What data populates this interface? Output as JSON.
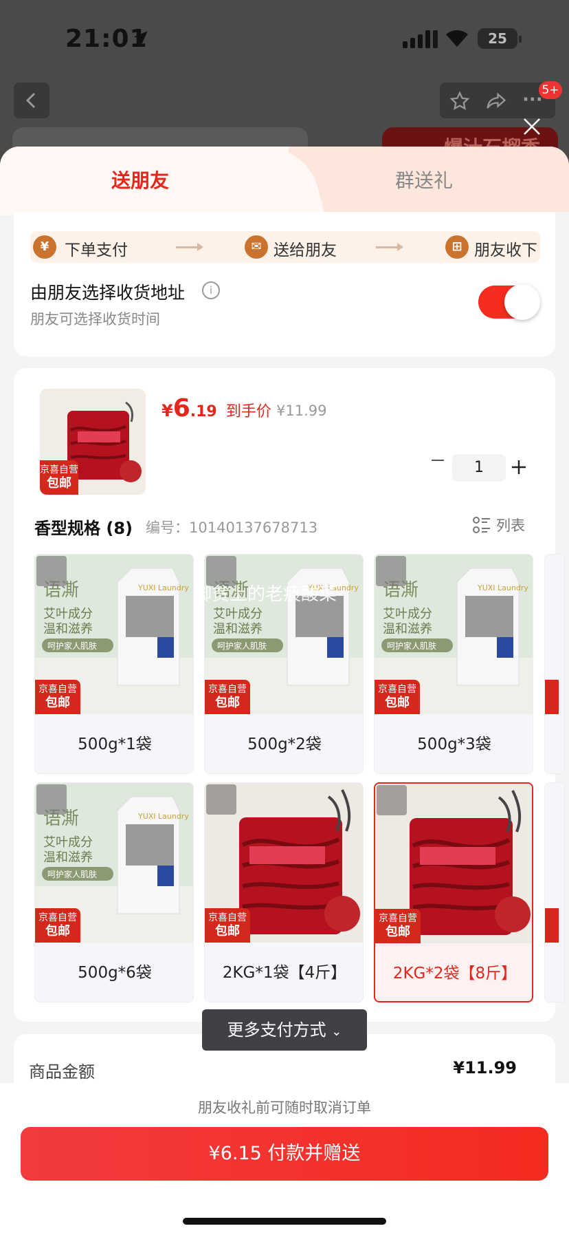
{
  "status_bar": {
    "time": "21:01",
    "battery": "25"
  },
  "nav": {
    "badge": "5+",
    "peek_banner": "爆汁石榴香"
  },
  "tabs": {
    "active": "送朋友",
    "inactive": "群送礼"
  },
  "flow": {
    "step1": "下单支付",
    "step2": "送给朋友",
    "step3": "朋友收下",
    "step1_icon": "¥"
  },
  "address": {
    "title": "由朋友选择收货地址",
    "subtitle": "朋友可选择收货时间",
    "toggle_on": true
  },
  "product": {
    "currency": "¥",
    "price_int": "6",
    "price_dec": ".19",
    "price_label": "到手价",
    "original_price": "¥11.99",
    "quantity": "1",
    "thumb_tag_top": "京喜自营",
    "thumb_tag_bottom": "包邮"
  },
  "spec": {
    "title": "香型规格 (8)",
    "code_label": "编号：10140137678713",
    "view_toggle": "列表"
  },
  "skus": [
    {
      "label": "500g*1袋",
      "tag_top": "京喜自营",
      "tag_bottom": "包邮"
    },
    {
      "label": "500g*2袋",
      "tag_top": "京喜自营",
      "tag_bottom": "包邮"
    },
    {
      "label": "500g*3袋",
      "tag_top": "京喜自营",
      "tag_bottom": "包邮"
    },
    {
      "label": "500g*6袋",
      "tag_top": "京喜自营",
      "tag_bottom": "包邮"
    },
    {
      "label": "2KG*1袋【4斤】",
      "tag_top": "京喜自营",
      "tag_bottom": "包邮"
    },
    {
      "label": "2KG*2袋【8斤】",
      "tag_top": "京喜自营",
      "tag_bottom": "包邮"
    }
  ],
  "sku_art": {
    "brand": "语澌",
    "line1": "艾叶成分",
    "line2": "温和滋养",
    "line3": "呵护家人肌肤",
    "pack": "YUXI Laundry"
  },
  "watermark": "脚贫上的老痰酸菜",
  "more_pay": "更多支付方式",
  "amount": {
    "label": "商品金额",
    "value": "¥11.99"
  },
  "footer": {
    "tip": "朋友收礼前可随时取消订单",
    "pay_button": "¥6.15 付款并赠送"
  },
  "colors": {
    "accent": "#e4271d",
    "pay_button": "#f23b3f",
    "flow_icon": "#c9732e"
  }
}
